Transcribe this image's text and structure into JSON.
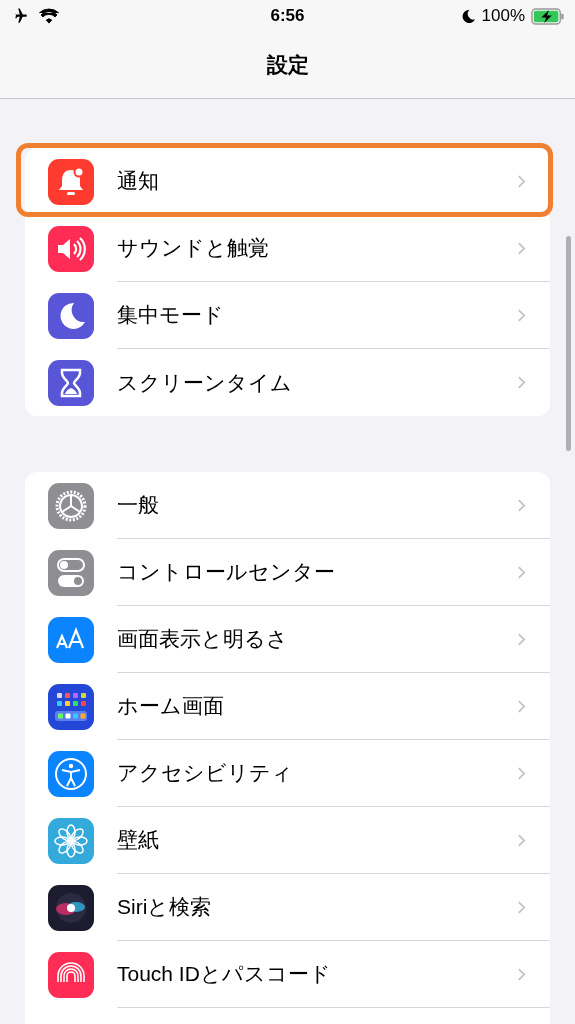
{
  "status_bar": {
    "time": "6:56",
    "battery": "100%",
    "airplane_mode": true,
    "do_not_disturb": true,
    "charging": true
  },
  "nav": {
    "title": "設定"
  },
  "groups": [
    {
      "items": [
        {
          "label": "通知",
          "color": "#ff3b30",
          "highlighted": true
        },
        {
          "label": "サウンドと触覚",
          "color": "#ff2d55",
          "highlighted": false
        },
        {
          "label": "集中モード",
          "color": "#5856d6",
          "highlighted": false
        },
        {
          "label": "スクリーンタイム",
          "color": "#5856d6",
          "highlighted": false
        }
      ]
    },
    {
      "items": [
        {
          "label": "一般",
          "color": "#8e8e93",
          "highlighted": false
        },
        {
          "label": "コントロールセンター",
          "color": "#8e8e93",
          "highlighted": false
        },
        {
          "label": "画面表示と明るさ",
          "color": "#0a84ff",
          "highlighted": false
        },
        {
          "label": "ホーム画面",
          "color": "#2447d8",
          "highlighted": false
        },
        {
          "label": "アクセシビリティ",
          "color": "#0a84ff",
          "highlighted": false
        },
        {
          "label": "壁紙",
          "color": "#34aadc",
          "highlighted": false
        },
        {
          "label": "Siriと検索",
          "color": "#1c1c2e",
          "highlighted": false
        },
        {
          "label": "Touch IDとパスコード",
          "color": "#ff2d55",
          "highlighted": false
        }
      ]
    }
  ]
}
